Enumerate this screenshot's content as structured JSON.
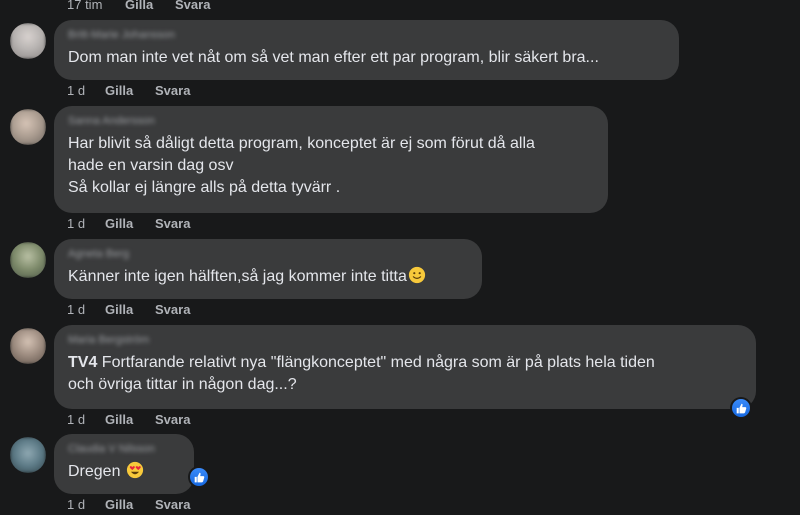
{
  "top_meta": {
    "time": "17 tim",
    "like": "Gilla",
    "reply": "Svara"
  },
  "comments": [
    {
      "author": "Britt-Marie Johansson",
      "lines": [
        "Dom man inte vet nåt om så vet man efter ett par program, blir säkert bra..."
      ],
      "time": "1 d",
      "like": "Gilla",
      "reply": "Svara",
      "avatar_color": "#b8b4b2"
    },
    {
      "author": "Sanna Andersson",
      "lines": [
        "Har blivit så dåligt detta program, konceptet är ej som förut då alla",
        "hade en varsin dag osv",
        "Så kollar ej längre alls på detta tyvärr ."
      ],
      "time": "1 d",
      "like": "Gilla",
      "reply": "Svara",
      "avatar_color": "#a89a8e"
    },
    {
      "author": "Agneta Berg",
      "lines": [
        "Känner inte igen hälften,så jag kommer inte titta"
      ],
      "emoji": "slightly-smiling-face-icon",
      "time": "1 d",
      "like": "Gilla",
      "reply": "Svara",
      "avatar_color": "#7d8a6a"
    },
    {
      "author": "Maria Bergström",
      "mention": "TV4",
      "lines": [
        " Fortfarande relativt nya \"flängkonceptet\" med några som är på plats hela tiden",
        "och övriga tittar in någon dag...?"
      ],
      "time": "1 d",
      "like": "Gilla",
      "reply": "Svara",
      "reaction": "like-icon",
      "avatar_color": "#9b8a7e"
    },
    {
      "author": "Claudia V Nilsson",
      "lines": [
        "Dregen"
      ],
      "emoji": "heart-eyes-face-icon",
      "time": "1 d",
      "like": "Gilla",
      "reply": "Svara",
      "reaction": "like-icon",
      "avatar_color": "#5c7a86"
    }
  ],
  "colors": {
    "background": "#18191a",
    "bubble": "#3a3b3c",
    "text": "#e4e6eb",
    "meta": "#b0b3b8",
    "like_blue": "#1877f2"
  }
}
